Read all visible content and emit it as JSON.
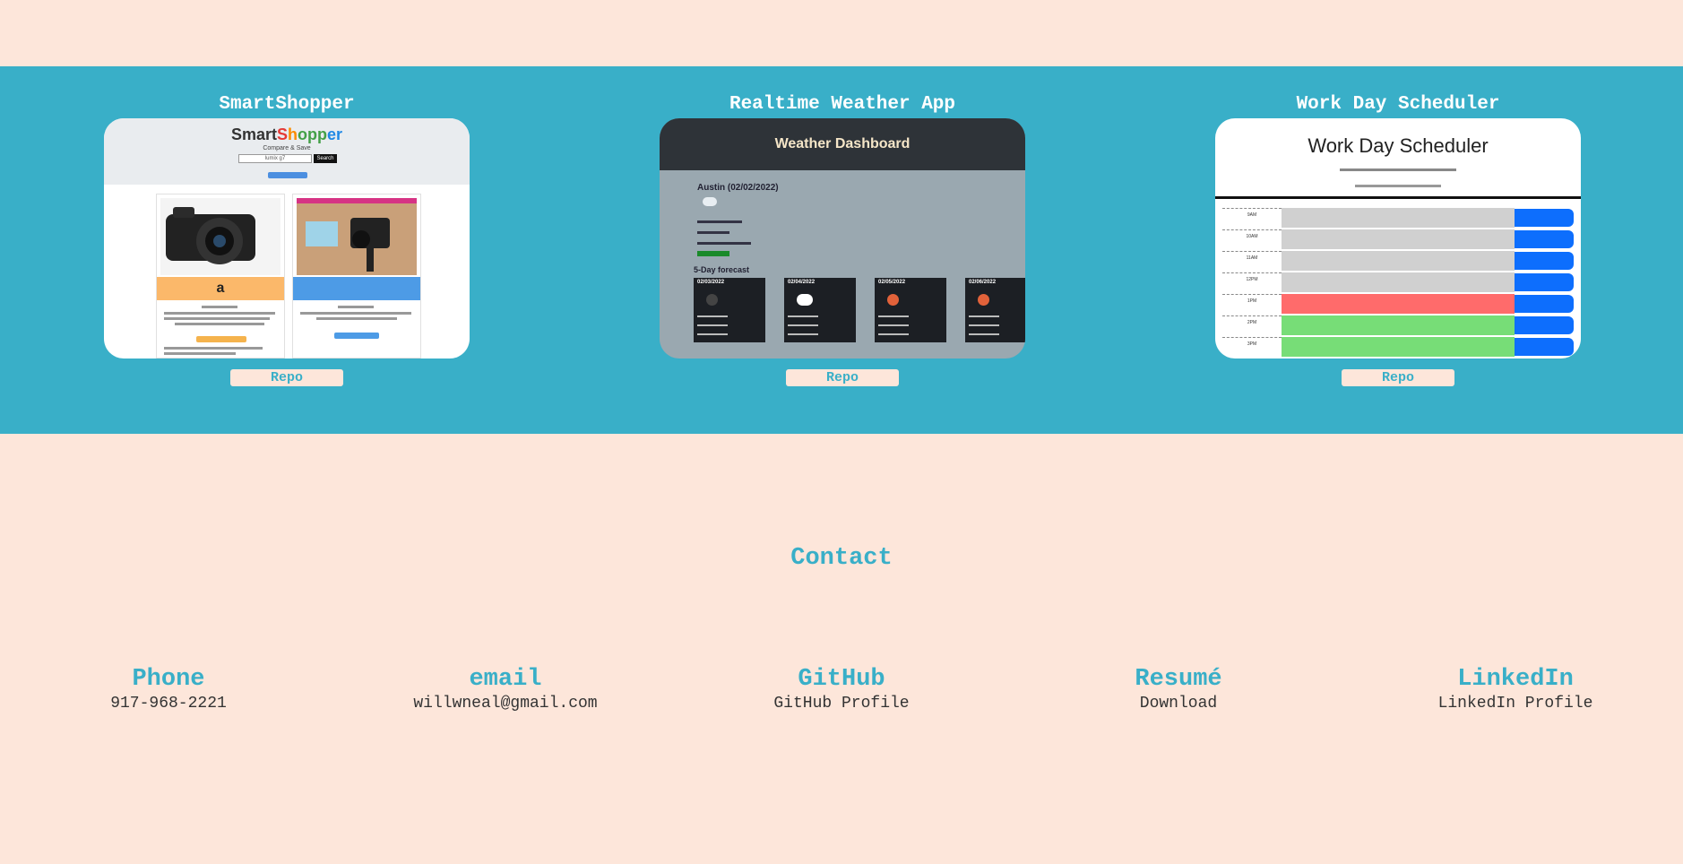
{
  "projects": [
    {
      "title": "SmartShopper",
      "repo_label": "Repo",
      "thumb": {
        "logo_parts": [
          "Smart",
          "S",
          "h",
          "opp",
          "er"
        ],
        "subtitle": "Compare & Save",
        "search_value": "lumix g7",
        "search_button": "Search"
      }
    },
    {
      "title": "Realtime Weather App",
      "repo_label": "Repo",
      "thumb": {
        "header": "Weather Dashboard",
        "city": "Austin (02/02/2022)",
        "forecast_label": "5-Day forecast",
        "days": [
          "02/03/2022",
          "02/04/2022",
          "02/05/2022",
          "02/06/2022"
        ]
      }
    },
    {
      "title": "Work Day Scheduler",
      "repo_label": "Repo",
      "thumb": {
        "header": "Work Day Scheduler",
        "hours": [
          "9AM",
          "10AM",
          "11AM",
          "12PM",
          "1PM",
          "2PM",
          "3PM"
        ]
      }
    }
  ],
  "contact": {
    "heading": "Contact",
    "items": [
      {
        "label": "Phone",
        "value": "917-968-2221"
      },
      {
        "label": "email",
        "value": "willwneal@gmail.com"
      },
      {
        "label": "GitHub",
        "value": "GitHub Profile"
      },
      {
        "label": "Resumé",
        "value": "Download"
      },
      {
        "label": "LinkedIn",
        "value": "LinkedIn Profile"
      }
    ]
  },
  "colors": {
    "background": "#fde6da",
    "accent": "#39afc8"
  }
}
